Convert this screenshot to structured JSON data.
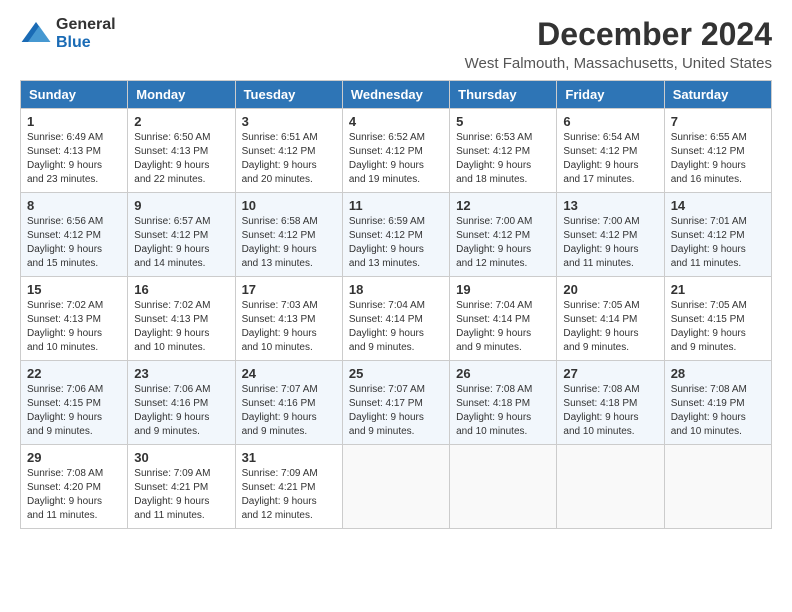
{
  "logo": {
    "general": "General",
    "blue": "Blue"
  },
  "title": "December 2024",
  "subtitle": "West Falmouth, Massachusetts, United States",
  "days_of_week": [
    "Sunday",
    "Monday",
    "Tuesday",
    "Wednesday",
    "Thursday",
    "Friday",
    "Saturday"
  ],
  "weeks": [
    [
      {
        "day": "1",
        "sunrise": "6:49 AM",
        "sunset": "4:13 PM",
        "daylight": "9 hours and 23 minutes."
      },
      {
        "day": "2",
        "sunrise": "6:50 AM",
        "sunset": "4:13 PM",
        "daylight": "9 hours and 22 minutes."
      },
      {
        "day": "3",
        "sunrise": "6:51 AM",
        "sunset": "4:12 PM",
        "daylight": "9 hours and 20 minutes."
      },
      {
        "day": "4",
        "sunrise": "6:52 AM",
        "sunset": "4:12 PM",
        "daylight": "9 hours and 19 minutes."
      },
      {
        "day": "5",
        "sunrise": "6:53 AM",
        "sunset": "4:12 PM",
        "daylight": "9 hours and 18 minutes."
      },
      {
        "day": "6",
        "sunrise": "6:54 AM",
        "sunset": "4:12 PM",
        "daylight": "9 hours and 17 minutes."
      },
      {
        "day": "7",
        "sunrise": "6:55 AM",
        "sunset": "4:12 PM",
        "daylight": "9 hours and 16 minutes."
      }
    ],
    [
      {
        "day": "8",
        "sunrise": "6:56 AM",
        "sunset": "4:12 PM",
        "daylight": "9 hours and 15 minutes."
      },
      {
        "day": "9",
        "sunrise": "6:57 AM",
        "sunset": "4:12 PM",
        "daylight": "9 hours and 14 minutes."
      },
      {
        "day": "10",
        "sunrise": "6:58 AM",
        "sunset": "4:12 PM",
        "daylight": "9 hours and 13 minutes."
      },
      {
        "day": "11",
        "sunrise": "6:59 AM",
        "sunset": "4:12 PM",
        "daylight": "9 hours and 13 minutes."
      },
      {
        "day": "12",
        "sunrise": "7:00 AM",
        "sunset": "4:12 PM",
        "daylight": "9 hours and 12 minutes."
      },
      {
        "day": "13",
        "sunrise": "7:00 AM",
        "sunset": "4:12 PM",
        "daylight": "9 hours and 11 minutes."
      },
      {
        "day": "14",
        "sunrise": "7:01 AM",
        "sunset": "4:12 PM",
        "daylight": "9 hours and 11 minutes."
      }
    ],
    [
      {
        "day": "15",
        "sunrise": "7:02 AM",
        "sunset": "4:13 PM",
        "daylight": "9 hours and 10 minutes."
      },
      {
        "day": "16",
        "sunrise": "7:02 AM",
        "sunset": "4:13 PM",
        "daylight": "9 hours and 10 minutes."
      },
      {
        "day": "17",
        "sunrise": "7:03 AM",
        "sunset": "4:13 PM",
        "daylight": "9 hours and 10 minutes."
      },
      {
        "day": "18",
        "sunrise": "7:04 AM",
        "sunset": "4:14 PM",
        "daylight": "9 hours and 9 minutes."
      },
      {
        "day": "19",
        "sunrise": "7:04 AM",
        "sunset": "4:14 PM",
        "daylight": "9 hours and 9 minutes."
      },
      {
        "day": "20",
        "sunrise": "7:05 AM",
        "sunset": "4:14 PM",
        "daylight": "9 hours and 9 minutes."
      },
      {
        "day": "21",
        "sunrise": "7:05 AM",
        "sunset": "4:15 PM",
        "daylight": "9 hours and 9 minutes."
      }
    ],
    [
      {
        "day": "22",
        "sunrise": "7:06 AM",
        "sunset": "4:15 PM",
        "daylight": "9 hours and 9 minutes."
      },
      {
        "day": "23",
        "sunrise": "7:06 AM",
        "sunset": "4:16 PM",
        "daylight": "9 hours and 9 minutes."
      },
      {
        "day": "24",
        "sunrise": "7:07 AM",
        "sunset": "4:16 PM",
        "daylight": "9 hours and 9 minutes."
      },
      {
        "day": "25",
        "sunrise": "7:07 AM",
        "sunset": "4:17 PM",
        "daylight": "9 hours and 9 minutes."
      },
      {
        "day": "26",
        "sunrise": "7:08 AM",
        "sunset": "4:18 PM",
        "daylight": "9 hours and 10 minutes."
      },
      {
        "day": "27",
        "sunrise": "7:08 AM",
        "sunset": "4:18 PM",
        "daylight": "9 hours and 10 minutes."
      },
      {
        "day": "28",
        "sunrise": "7:08 AM",
        "sunset": "4:19 PM",
        "daylight": "9 hours and 10 minutes."
      }
    ],
    [
      {
        "day": "29",
        "sunrise": "7:08 AM",
        "sunset": "4:20 PM",
        "daylight": "9 hours and 11 minutes."
      },
      {
        "day": "30",
        "sunrise": "7:09 AM",
        "sunset": "4:21 PM",
        "daylight": "9 hours and 11 minutes."
      },
      {
        "day": "31",
        "sunrise": "7:09 AM",
        "sunset": "4:21 PM",
        "daylight": "9 hours and 12 minutes."
      },
      null,
      null,
      null,
      null
    ]
  ],
  "labels": {
    "sunrise": "Sunrise:",
    "sunset": "Sunset:",
    "daylight": "Daylight:"
  }
}
